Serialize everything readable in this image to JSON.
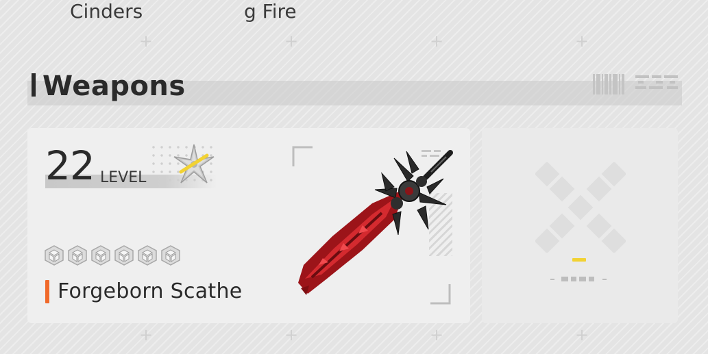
{
  "top_row": {
    "items": [
      {
        "label": "Cinders"
      },
      {
        "label": "g Fire"
      }
    ]
  },
  "weapons_section": {
    "title": "Weapons"
  },
  "weapon_card": {
    "level": "22",
    "level_label": "LEVEL",
    "name": "Forgeborn Scathe",
    "star_count": 6,
    "rank_icon": "shuriken-rank-icon",
    "accent_color": "#f0692a",
    "weapon_icon": "red-greatsword-icon"
  },
  "empty_slot": {
    "icon": "empty-slot-x-icon",
    "accent_color": "#f2d233"
  }
}
